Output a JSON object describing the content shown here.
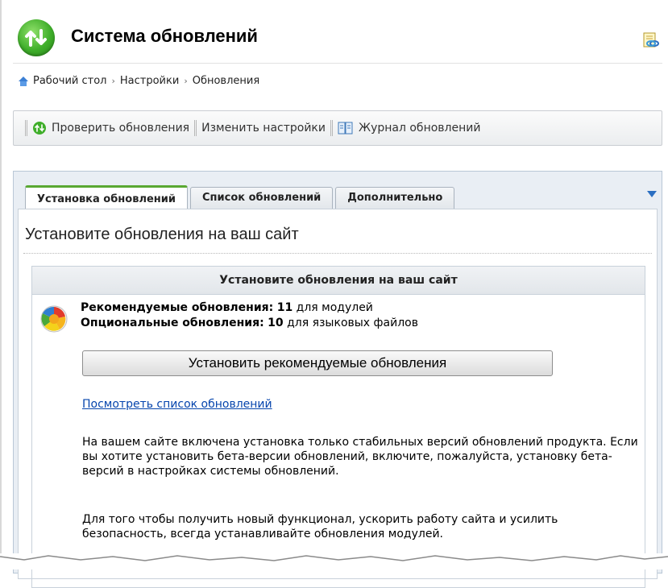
{
  "header": {
    "title": "Система обновлений"
  },
  "breadcrumb": {
    "items": [
      "Рабочий стол",
      "Настройки",
      "Обновления"
    ],
    "separator": "›"
  },
  "toolbar": {
    "check_label": "Проверить обновления",
    "settings_label": "Изменить настройки",
    "log_label": "Журнал обновлений"
  },
  "tabs": [
    {
      "label": "Установка обновлений",
      "active": true
    },
    {
      "label": "Список обновлений",
      "active": false
    },
    {
      "label": "Дополнительно",
      "active": false
    }
  ],
  "main": {
    "section_title": "Установите обновления на ваш сайт",
    "box_title": "Установите обновления на ваш сайт",
    "recommended_label": "Рекомендуемые обновления:",
    "recommended_count": "11",
    "recommended_suffix": "для модулей",
    "optional_label": "Опциональные обновления:",
    "optional_count": "10",
    "optional_suffix": "для языковых файлов",
    "install_button": "Установить рекомендуемые обновления",
    "view_list_link": "Посмотреть список обновлений",
    "paragraph1": "На вашем сайте включена установка только стабильных версий обновлений продукта. Если вы хотите установить бета-версии обновлений, включите, пожалуйста, установку бета-версий в настройках системы обновлений.",
    "paragraph2": "Для того чтобы получить новый функционал, ускорить работу сайта и усилить безопасность, всегда устанавливайте обновления модулей."
  },
  "colors": {
    "accent_green": "#5aa832",
    "link_blue": "#0645ad",
    "panel_bg": "#e9eef4"
  }
}
